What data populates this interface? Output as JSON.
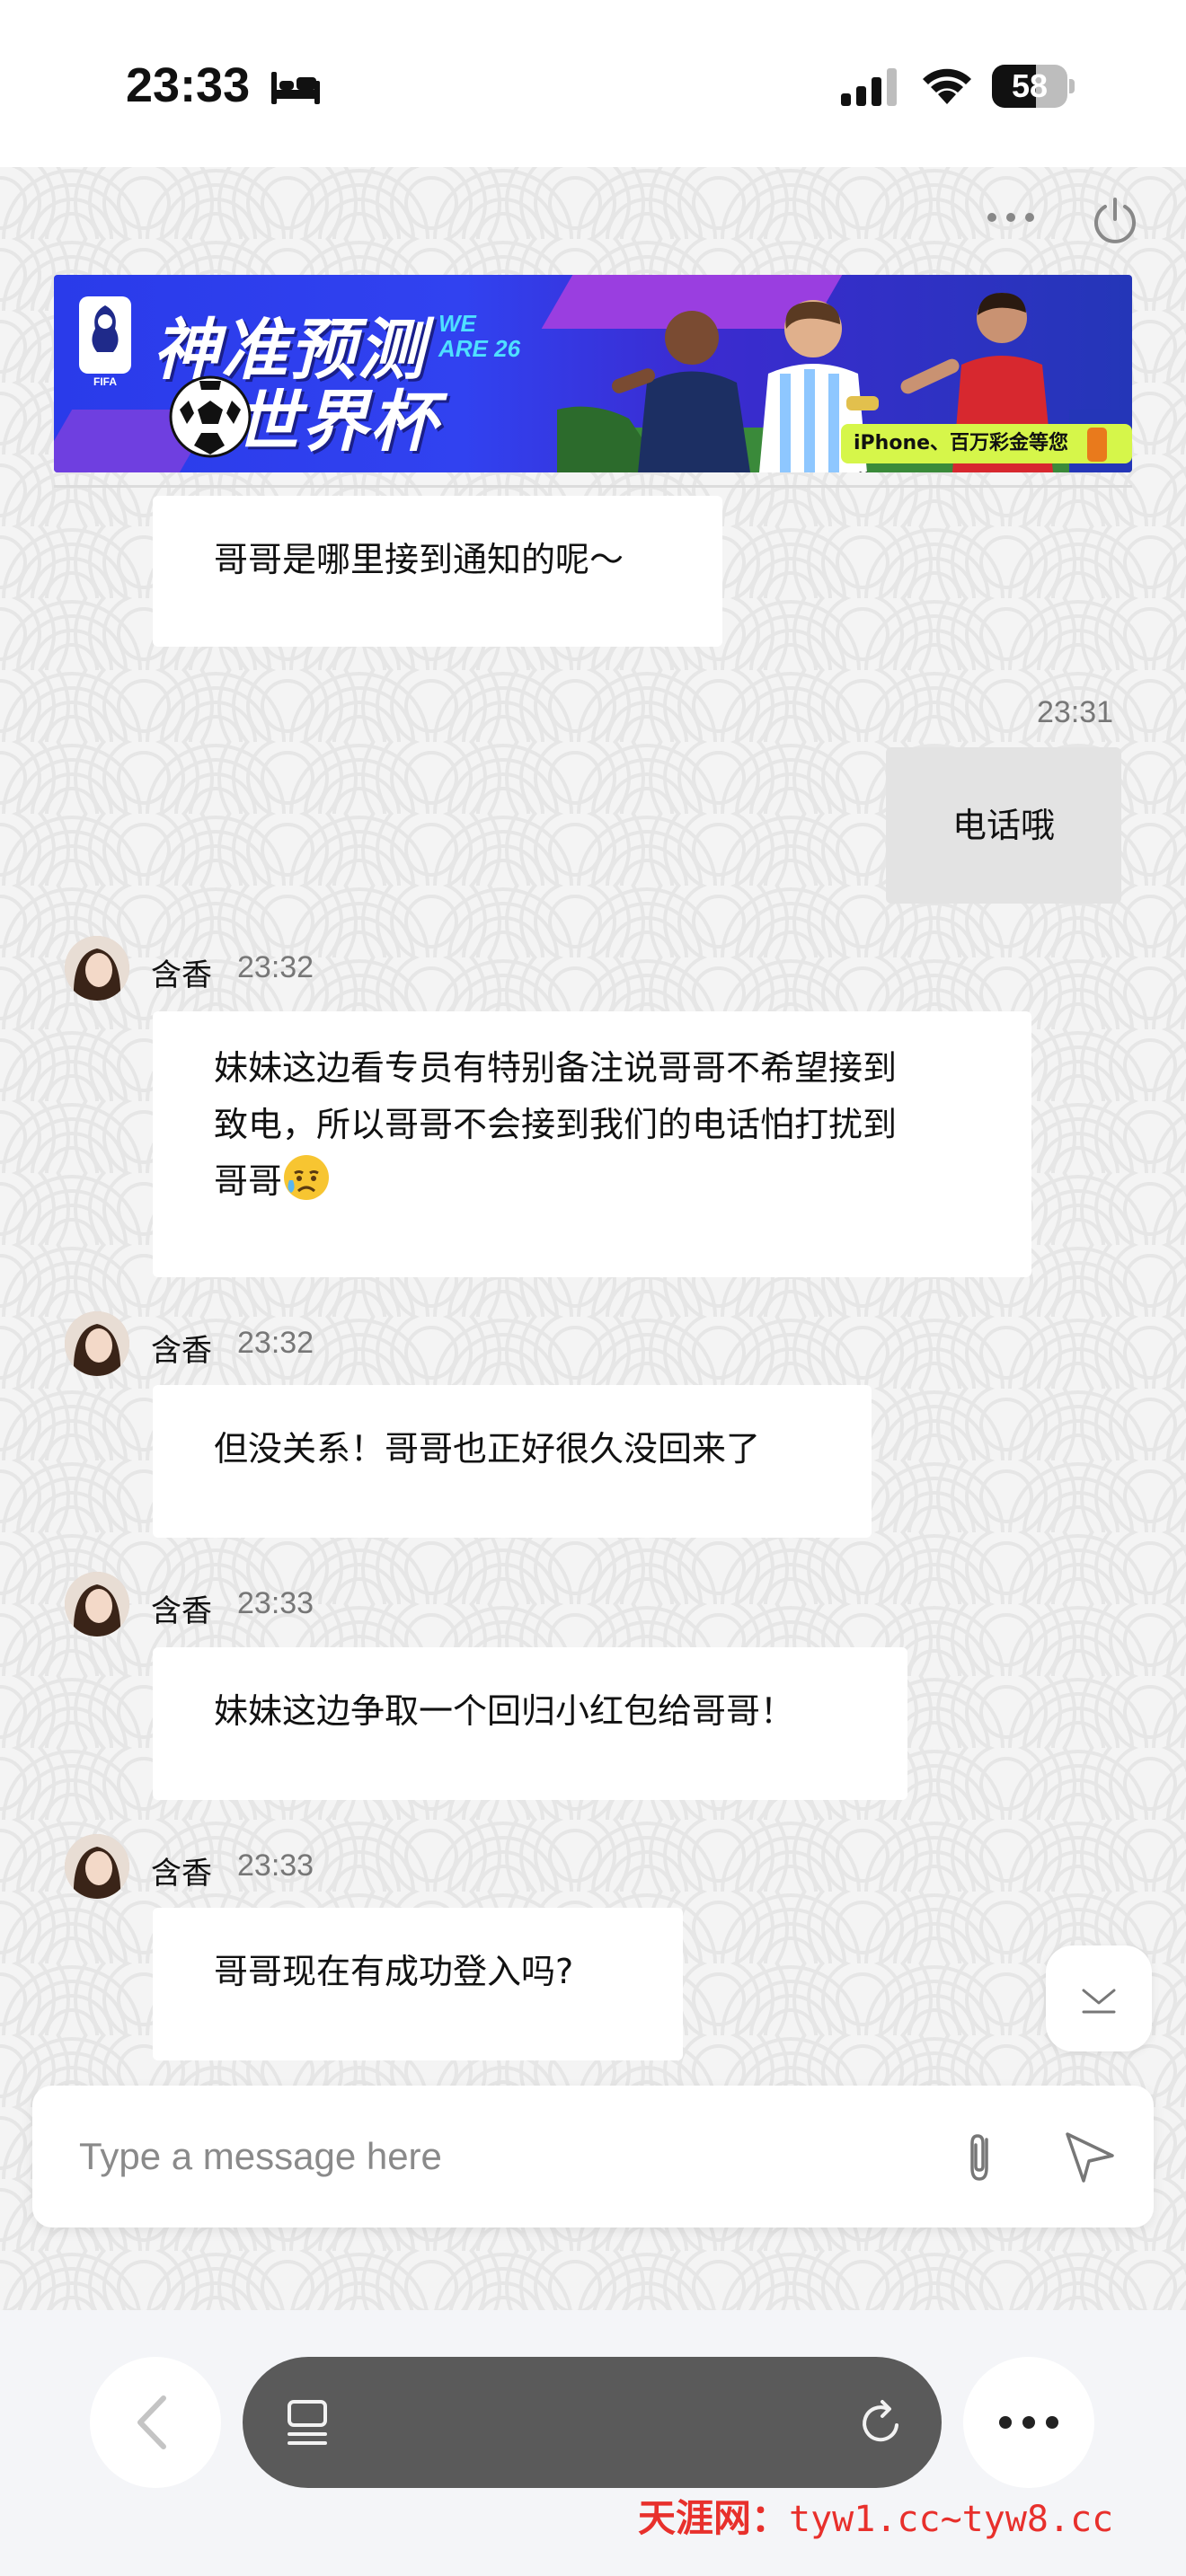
{
  "status_bar": {
    "time": "23:33",
    "battery": "58",
    "battery_level": 0.58,
    "icons": [
      "bed-icon",
      "signal-icon",
      "wifi-icon",
      "battery-icon"
    ]
  },
  "header": {
    "icons": [
      "more-icon",
      "power-icon"
    ]
  },
  "banner": {
    "title_line1": "神准预测",
    "title_line2": "世界杯",
    "tag_line1": "WE",
    "tag_line2": "ARE 26",
    "fifa_label": "FIFA",
    "cta": "iPhone、百万彩金等您分!"
  },
  "messages": [
    {
      "side": "agent",
      "text": "哥哥是哪里接到通知的呢～"
    },
    {
      "side": "user",
      "time": "23:31",
      "text": "电话哦"
    },
    {
      "side": "agent",
      "sender": "含香",
      "time": "23:32",
      "lines": [
        "妹妹这边看专员有特别备注说哥哥不希望接到",
        "致电，所以哥哥不会接到我们的电话怕打扰到",
        "哥哥"
      ],
      "emoji": "sad-relieved-emoji"
    },
    {
      "side": "agent",
      "sender": "含香",
      "time": "23:32",
      "text": "但没关系！哥哥也正好很久没回来了"
    },
    {
      "side": "agent",
      "sender": "含香",
      "time": "23:33",
      "text": "妹妹这边争取一个回归小红包给哥哥！"
    },
    {
      "side": "agent",
      "sender": "含香",
      "time": "23:33",
      "text": "哥哥现在有成功登入吗?"
    }
  ],
  "composer": {
    "placeholder": "Type a message here",
    "icons": [
      "attach-icon",
      "send-icon"
    ]
  },
  "browser_bar": {
    "icons": [
      "back-icon",
      "tabs-icon",
      "reload-icon",
      "more-icon"
    ]
  },
  "watermark": {
    "site_name": "天涯网：",
    "domains": "tyw1.cc~tyw8.cc"
  },
  "colors": {
    "chat_background": "#f4f4f4",
    "agent_bubble": "#ffffff",
    "user_bubble": "#e3e3e3",
    "watermark": "#e8302c",
    "banner_blue": "#2a3bea",
    "banner_cta": "#d6f64a"
  }
}
